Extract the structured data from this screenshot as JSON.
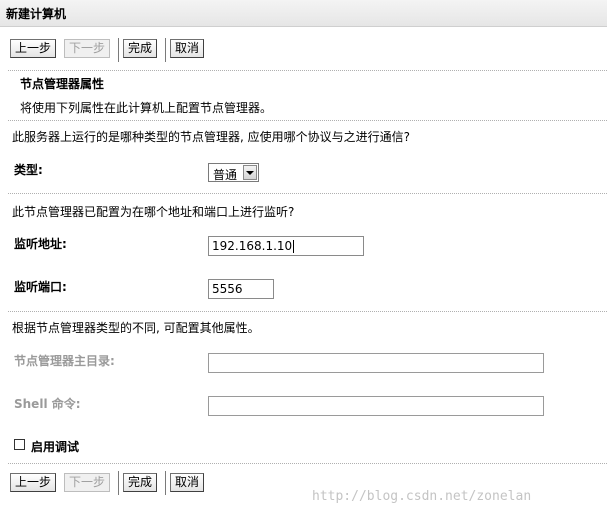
{
  "header": {
    "title": "新建计算机"
  },
  "buttons": {
    "back": "上一步",
    "next": "下一步",
    "finish": "完成",
    "cancel": "取消"
  },
  "section": {
    "title": "节点管理器属性",
    "description": "将使用下列属性在此计算机上配置节点管理器。"
  },
  "protocol": {
    "question": "此服务器上运行的是哪种类型的节点管理器, 应使用哪个协议与之进行通信?",
    "type_label": "类型:",
    "type_value": "普通"
  },
  "listen": {
    "question": "此节点管理器已配置为在哪个地址和端口上进行监听?",
    "address_label": "监听地址:",
    "address_value": "192.168.1.10",
    "port_label": "监听端口:",
    "port_value": "5556"
  },
  "other": {
    "note": "根据节点管理器类型的不同, 可配置其他属性。",
    "home_label": "节点管理器主目录:",
    "home_value": "",
    "shell_label": "Shell 命令:",
    "shell_value": ""
  },
  "debug": {
    "label": "启用调试",
    "checked": false
  },
  "watermark": "http://blog.csdn.net/zonelan"
}
